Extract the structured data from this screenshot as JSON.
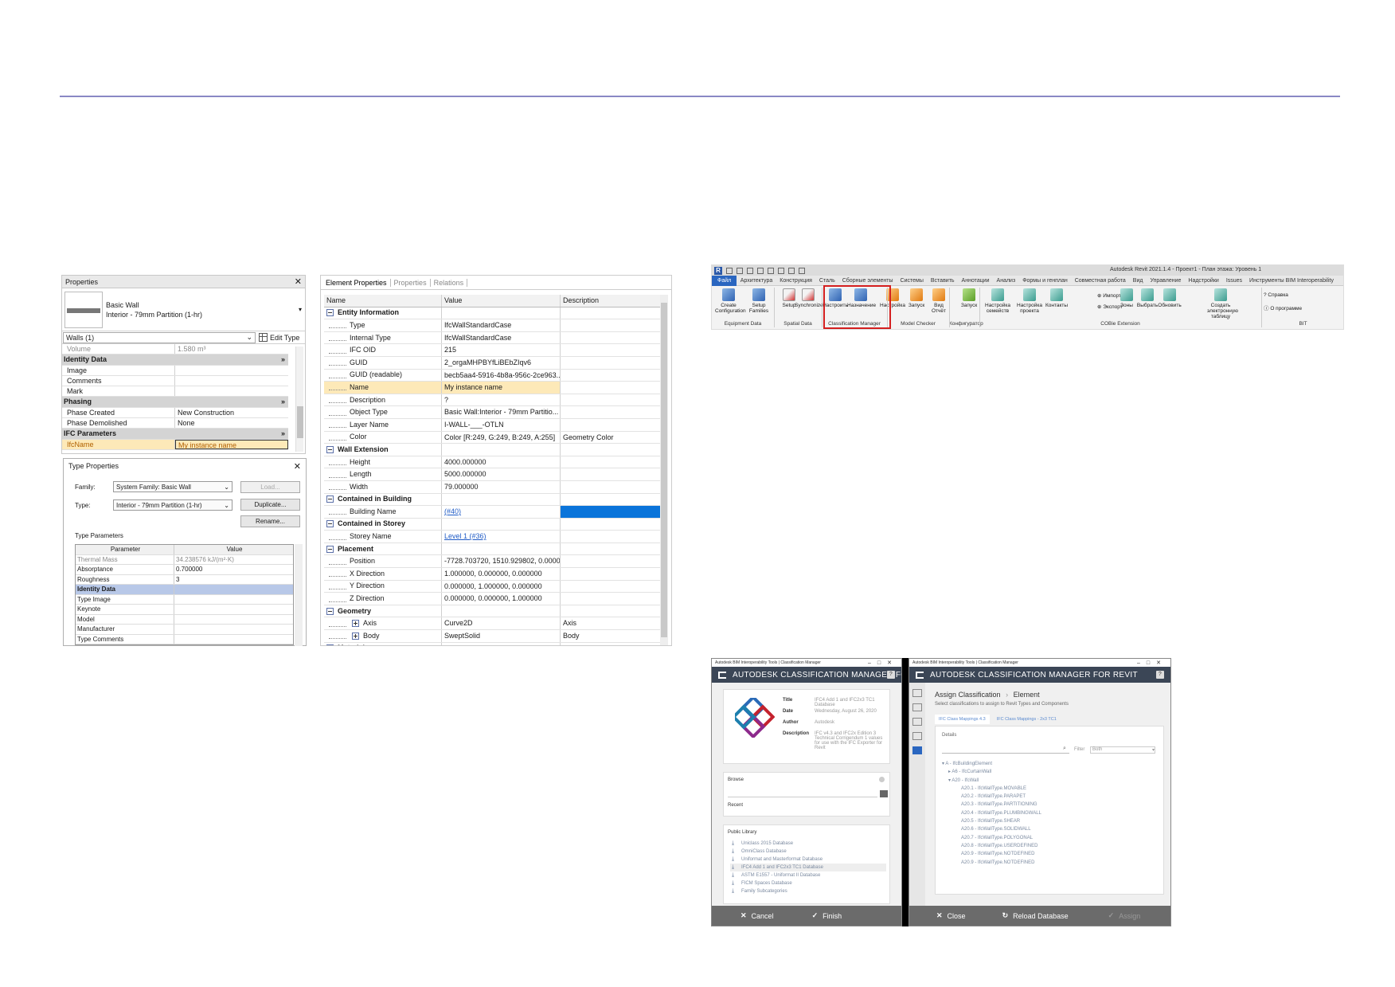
{
  "properties": {
    "title": "Properties",
    "family": "Basic Wall",
    "type": "Interior - 79mm Partition (1-hr)",
    "selector": "Walls (1)",
    "edit_type": "Edit Type",
    "rows": [
      {
        "k": "Volume",
        "v": "1.580 m³",
        "style": "dim"
      },
      {
        "k": "Identity Data",
        "v": "»",
        "style": "grp"
      },
      {
        "k": "Image",
        "v": "",
        "style": ""
      },
      {
        "k": "Comments",
        "v": "",
        "style": ""
      },
      {
        "k": "Mark",
        "v": "",
        "style": ""
      },
      {
        "k": "Phasing",
        "v": "»",
        "style": "grp"
      },
      {
        "k": "Phase Created",
        "v": "New Construction",
        "style": ""
      },
      {
        "k": "Phase Demolished",
        "v": "None",
        "style": ""
      },
      {
        "k": "IFC Parameters",
        "v": "»",
        "style": "grp"
      },
      {
        "k": "IfcName",
        "v": "My instance name",
        "style": "hl"
      }
    ]
  },
  "type_properties": {
    "title": "Type Properties",
    "family_label": "Family:",
    "family_value": "System Family: Basic Wall",
    "type_label": "Type:",
    "type_value": "Interior - 79mm Partition (1-hr)",
    "load": "Load...",
    "duplicate": "Duplicate...",
    "rename": "Rename...",
    "params_label": "Type Parameters",
    "col_param": "Parameter",
    "col_value": "Value",
    "rows": [
      {
        "k": "Thermal Mass",
        "v": "34.238576 kJ/(m²·K)",
        "style": "dim"
      },
      {
        "k": "Absorptance",
        "v": "0.700000",
        "style": ""
      },
      {
        "k": "Roughness",
        "v": "3",
        "style": ""
      },
      {
        "k": "Identity Data",
        "v": "",
        "style": "grp"
      },
      {
        "k": "Type Image",
        "v": "",
        "style": ""
      },
      {
        "k": "Keynote",
        "v": "",
        "style": ""
      },
      {
        "k": "Model",
        "v": "",
        "style": ""
      },
      {
        "k": "Manufacturer",
        "v": "",
        "style": ""
      },
      {
        "k": "Type Comments",
        "v": "",
        "style": ""
      }
    ]
  },
  "element_properties": {
    "tabs": [
      "Element Properties",
      "Properties",
      "Relations"
    ],
    "columns": [
      "Name",
      "Value",
      "Description"
    ],
    "rows": [
      {
        "n": "Entity Information",
        "v": "",
        "d": "",
        "kind": "grp"
      },
      {
        "n": "Type",
        "v": "IfcWallStandardCase",
        "d": "",
        "kind": "item"
      },
      {
        "n": "Internal Type",
        "v": "IfcWallStandardCase",
        "d": "",
        "kind": "item"
      },
      {
        "n": "IFC OID",
        "v": "215",
        "d": "",
        "kind": "item"
      },
      {
        "n": "GUID",
        "v": "2_orgaMHPBYfLiBEbZIqv6",
        "d": "",
        "kind": "item"
      },
      {
        "n": "GUID (readable)",
        "v": "becb5aa4-5916-4b8a-956c-2ce963...",
        "d": "",
        "kind": "item"
      },
      {
        "n": "Name",
        "v": "My instance name",
        "d": "",
        "kind": "hl"
      },
      {
        "n": "Description",
        "v": "?",
        "d": "",
        "kind": "item"
      },
      {
        "n": "Object Type",
        "v": "Basic Wall:Interior - 79mm Partitio...",
        "d": "",
        "kind": "item"
      },
      {
        "n": "Layer Name",
        "v": "I-WALL-___-OTLN",
        "d": "",
        "kind": "item"
      },
      {
        "n": "Color",
        "v": "Color [R:249, G:249, B:249, A:255]",
        "d": "Geometry Color",
        "kind": "item"
      },
      {
        "n": "Wall Extension",
        "v": "",
        "d": "",
        "kind": "grp"
      },
      {
        "n": "Height",
        "v": "4000.000000",
        "d": "",
        "kind": "item"
      },
      {
        "n": "Length",
        "v": "5000.000000",
        "d": "",
        "kind": "item"
      },
      {
        "n": "Width",
        "v": "79.000000",
        "d": "",
        "kind": "item"
      },
      {
        "n": "Contained in Building",
        "v": "",
        "d": "",
        "kind": "grp"
      },
      {
        "n": "Building Name",
        "v": "(#40)",
        "d": "",
        "kind": "link-blue"
      },
      {
        "n": "Contained in Storey",
        "v": "",
        "d": "",
        "kind": "grp"
      },
      {
        "n": "Storey Name",
        "v": "Level 1 (#36)",
        "d": "",
        "kind": "link"
      },
      {
        "n": "Placement",
        "v": "",
        "d": "",
        "kind": "grp"
      },
      {
        "n": "Position",
        "v": "-7728.703720, 1510.929802, 0.000000",
        "d": "",
        "kind": "item"
      },
      {
        "n": "X Direction",
        "v": "1.000000, 0.000000, 0.000000",
        "d": "",
        "kind": "item"
      },
      {
        "n": "Y Direction",
        "v": "0.000000, 1.000000, 0.000000",
        "d": "",
        "kind": "item"
      },
      {
        "n": "Z Direction",
        "v": "0.000000, 0.000000, 1.000000",
        "d": "",
        "kind": "item"
      },
      {
        "n": "Geometry",
        "v": "",
        "d": "",
        "kind": "grp"
      },
      {
        "n": "Axis",
        "v": "Curve2D",
        "d": "Axis",
        "kind": "sub"
      },
      {
        "n": "Body",
        "v": "SweptSolid",
        "d": "Body",
        "kind": "sub"
      },
      {
        "n": "Material",
        "v": "",
        "d": "",
        "kind": "grp"
      }
    ]
  },
  "ribbon": {
    "app_title": "Autodesk Revit 2021.1.4 - Проект1 - План этажа: Уровень 1",
    "menu": [
      "Файл",
      "Архитектура",
      "Конструкция",
      "Сталь",
      "Сборные элементы",
      "Системы",
      "Вставить",
      "Аннотации",
      "Анализ",
      "Формы и генплан",
      "Совместная работа",
      "Вид",
      "Управление",
      "Надстройки",
      "Issues",
      "Инструменты BIM Interoperability"
    ],
    "tools": [
      {
        "l1": "Create",
        "l2": "Configuration",
        "color": "blue"
      },
      {
        "l1": "Setup",
        "l2": "Families",
        "color": "blue"
      },
      {
        "l1": "Setup",
        "l2": "",
        "color": "red"
      },
      {
        "l1": "Synchronize",
        "l2": "",
        "color": "red"
      },
      {
        "l1": "Настроить",
        "l2": "",
        "color": "blue"
      },
      {
        "l1": "Назначение",
        "l2": "",
        "color": "blue"
      },
      {
        "l1": "Настройка",
        "l2": "",
        "color": "orange"
      },
      {
        "l1": "Запуск",
        "l2": "",
        "color": "orange"
      },
      {
        "l1": "Вид",
        "l2": "Отчёт",
        "color": "orange"
      },
      {
        "l1": "Запуск",
        "l2": "",
        "color": "green"
      },
      {
        "l1": "Настройка",
        "l2": "семейств",
        "color": "teal"
      },
      {
        "l1": "Настройка",
        "l2": "проекта",
        "color": "teal"
      },
      {
        "l1": "Контакты",
        "l2": "",
        "color": "teal"
      },
      {
        "l1": "Зоны",
        "l2": "",
        "color": "teal"
      },
      {
        "l1": "Выбрать",
        "l2": "",
        "color": "teal"
      },
      {
        "l1": "Обновить",
        "l2": "",
        "color": "teal"
      },
      {
        "l1": "Создать",
        "l2": "электронную таблицу",
        "color": "teal"
      }
    ],
    "small": {
      "import": "Импорт",
      "export": "Экспорт",
      "help": "Справка",
      "about": "О программе"
    },
    "groups": [
      "Equipment Data",
      "Spatial Data",
      "Classification Manager",
      "Model Checker",
      "Конфигуратор",
      "COBie Extension",
      "BIT"
    ]
  },
  "cm_left": {
    "window_title": "Autodesk BIM Interoperability Tools | Classification Manager",
    "header": "AUTODESK CLASSIFICATION MANAGER FOR",
    "info": [
      {
        "k": "Title",
        "v": "IFC4 Add 1 and IFC2x3 TC1 Database"
      },
      {
        "k": "Date",
        "v": "Wednesday, August 26, 2020"
      },
      {
        "k": "Author",
        "v": "Autodesk"
      },
      {
        "k": "Description",
        "v": "IFC v4.3 and IFC2x Edition 3 Technical Corrigendum 1 values for use with the IFC Exporter for Revit"
      }
    ],
    "browse": "Browse",
    "recent": "Recent",
    "public_library": "Public Library",
    "libraries": [
      "Uniclass 2015 Database",
      "OmniClass Database",
      "Uniformat and Masterformat Database",
      "IFC4 Add 1 and IFC2x3 TC1 Database",
      "ASTM E1557 - Uniformat II Database",
      "FICM Spaces Database",
      "Family Subcategories"
    ],
    "cancel": "Cancel",
    "finish": "Finish"
  },
  "cm_right": {
    "window_title": "Autodesk BIM Interoperability Tools | Classification Manager",
    "header": "AUTODESK CLASSIFICATION MANAGER FOR REVIT",
    "crumb1": "Assign Classification",
    "crumb_sep": "›",
    "crumb2": "Element",
    "subtitle": "Select classifications to assign to Revit Types and Components",
    "tab1": "IFC Class Mappings 4.3",
    "tab2": "IFC Class Mappings - 2x3 TC1",
    "details": "Details",
    "filter_label": "Filter",
    "filter_value": "Both",
    "tree": [
      "▾ A - IfcBuildingElement",
      "▸ A6 - IfcCurtainWall",
      "▾ A20 - IfcWall",
      "A20.1 - IfcWallType.MOVABLE",
      "A20.2 - IfcWallType.PARAPET",
      "A20.3 - IfcWallType.PARTITIONING",
      "A20.4 - IfcWallType.PLUMBINGWALL",
      "A20.5 - IfcWallType.SHEAR",
      "A20.6 - IfcWallType.SOLIDWALL",
      "A20.7 - IfcWallType.POLYGONAL",
      "A20.8 - IfcWallType.USERDEFINED",
      "A20.9 - IfcWallType.NOTDEFINED",
      "A20.9 - IfcWallType.NOTDEFINED"
    ],
    "close": "Close",
    "reload": "Reload Database",
    "assign": "Assign"
  }
}
